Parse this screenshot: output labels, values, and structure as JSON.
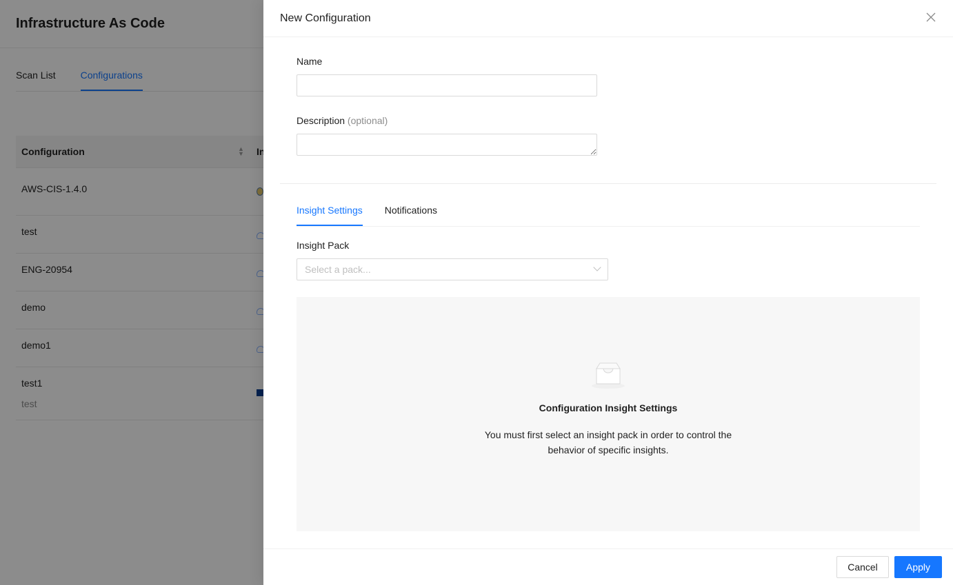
{
  "background": {
    "title": "Infrastructure As Code",
    "tabs": [
      {
        "label": "Scan List",
        "active": false
      },
      {
        "label": "Configurations",
        "active": true
      }
    ],
    "table": {
      "header": "Configuration",
      "header2": "In",
      "rows": [
        {
          "name": "AWS-CIS-1.4.0",
          "sub": ""
        },
        {
          "name": "test",
          "sub": ""
        },
        {
          "name": "ENG-20954",
          "sub": ""
        },
        {
          "name": "demo",
          "sub": ""
        },
        {
          "name": "demo1",
          "sub": ""
        },
        {
          "name": "test1",
          "sub": "test"
        }
      ]
    }
  },
  "drawer": {
    "title": "New Configuration",
    "close_icon": "close-icon",
    "name_label": "Name",
    "name_value": "",
    "description_label": "Description",
    "description_optional": "(optional)",
    "description_value": "",
    "tabs": [
      {
        "label": "Insight Settings",
        "active": true
      },
      {
        "label": "Notifications",
        "active": false
      }
    ],
    "insight_pack_label": "Insight Pack",
    "insight_pack_placeholder": "Select a pack...",
    "empty_state": {
      "icon": "inbox-icon",
      "title": "Configuration Insight Settings",
      "description": "You must first select an insight pack in order to control the behavior of specific insights."
    },
    "footer": {
      "cancel_label": "Cancel",
      "apply_label": "Apply"
    }
  },
  "colors": {
    "accent": "#1677ff",
    "overlay": "rgba(0,0,0,0.45)"
  }
}
